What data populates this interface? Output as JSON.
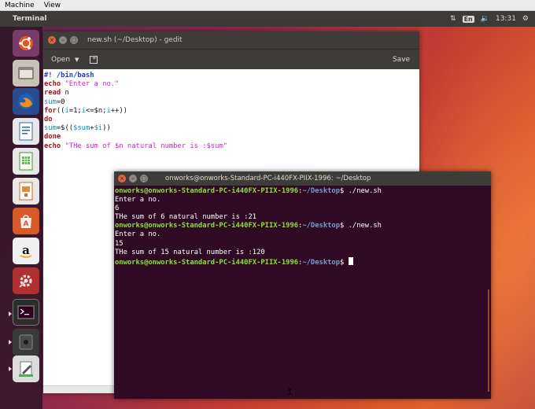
{
  "host_menu": {
    "items": [
      "Machine",
      "View"
    ]
  },
  "top_panel": {
    "app_title": "Terminal",
    "lang": "En",
    "time": "13:31"
  },
  "launcher": {
    "items": [
      "ubuntu-dash-icon",
      "files-icon",
      "firefox-icon",
      "writer-icon",
      "calc-icon",
      "impress-icon",
      "software-center-icon",
      "amazon-icon",
      "settings-icon",
      "terminal-icon",
      "disk-icon",
      "text-editor-icon"
    ]
  },
  "gedit": {
    "title": "new.sh (~/Desktop) - gedit",
    "open_label": "Open",
    "save_label": "Save",
    "code": [
      [
        {
          "t": "#! /bin/bash",
          "c": "shebang"
        }
      ],
      [
        {
          "t": "echo ",
          "c": "kw"
        },
        {
          "t": "\"Enter a no.\"",
          "c": "str"
        }
      ],
      [
        {
          "t": "read",
          "c": "kw"
        },
        {
          "t": " n",
          "c": "plain"
        }
      ],
      [
        {
          "t": "sum",
          "c": "var"
        },
        {
          "t": "=0",
          "c": "plain"
        }
      ],
      [
        {
          "t": "for",
          "c": "kw"
        },
        {
          "t": "((",
          "c": "plain"
        },
        {
          "t": "i",
          "c": "var"
        },
        {
          "t": "=1;",
          "c": "plain"
        },
        {
          "t": "i",
          "c": "var"
        },
        {
          "t": "<=$n;",
          "c": "plain"
        },
        {
          "t": "i",
          "c": "var"
        },
        {
          "t": "++))",
          "c": "plain"
        }
      ],
      [
        {
          "t": "do",
          "c": "kw"
        }
      ],
      [
        {
          "t": "sum",
          "c": "var"
        },
        {
          "t": "=$((",
          "c": "plain"
        },
        {
          "t": "$sum",
          "c": "var"
        },
        {
          "t": "+",
          "c": "plain"
        },
        {
          "t": "$i",
          "c": "var"
        },
        {
          "t": "))",
          "c": "plain"
        }
      ],
      [
        {
          "t": "done",
          "c": "kw"
        }
      ],
      [
        {
          "t": "echo ",
          "c": "kw"
        },
        {
          "t": "\"THe sum of $n natural number is :$sum\"",
          "c": "str"
        }
      ]
    ]
  },
  "terminal": {
    "title": "onworks@onworks-Standard-PC-i440FX-PIIX-1996: ~/Desktop",
    "lines": [
      [
        {
          "t": "onworks@onworks-Standard-PC-i440FX-PIIX-1996",
          "c": "user"
        },
        {
          "t": ":",
          "c": "plain"
        },
        {
          "t": "~/Desktop",
          "c": "path"
        },
        {
          "t": "$ ./new.sh",
          "c": "plain"
        }
      ],
      [
        {
          "t": "Enter a no.",
          "c": "plain"
        }
      ],
      [
        {
          "t": "6",
          "c": "plain"
        }
      ],
      [
        {
          "t": "THe sum of 6 natural number is :21",
          "c": "plain"
        }
      ],
      [
        {
          "t": "onworks@onworks-Standard-PC-i440FX-PIIX-1996",
          "c": "user"
        },
        {
          "t": ":",
          "c": "plain"
        },
        {
          "t": "~/Desktop",
          "c": "path"
        },
        {
          "t": "$ ./new.sh",
          "c": "plain"
        }
      ],
      [
        {
          "t": "Enter a no.",
          "c": "plain"
        }
      ],
      [
        {
          "t": "15",
          "c": "plain"
        }
      ],
      [
        {
          "t": "THe sum of 15 natural number is :120",
          "c": "plain"
        }
      ],
      [
        {
          "t": "onworks@onworks-Standard-PC-i440FX-PIIX-1996",
          "c": "user"
        },
        {
          "t": ":",
          "c": "plain"
        },
        {
          "t": "~/Desktop",
          "c": "path"
        },
        {
          "t": "$ ",
          "c": "plain"
        },
        {
          "t": "",
          "c": "cursor"
        }
      ]
    ]
  }
}
